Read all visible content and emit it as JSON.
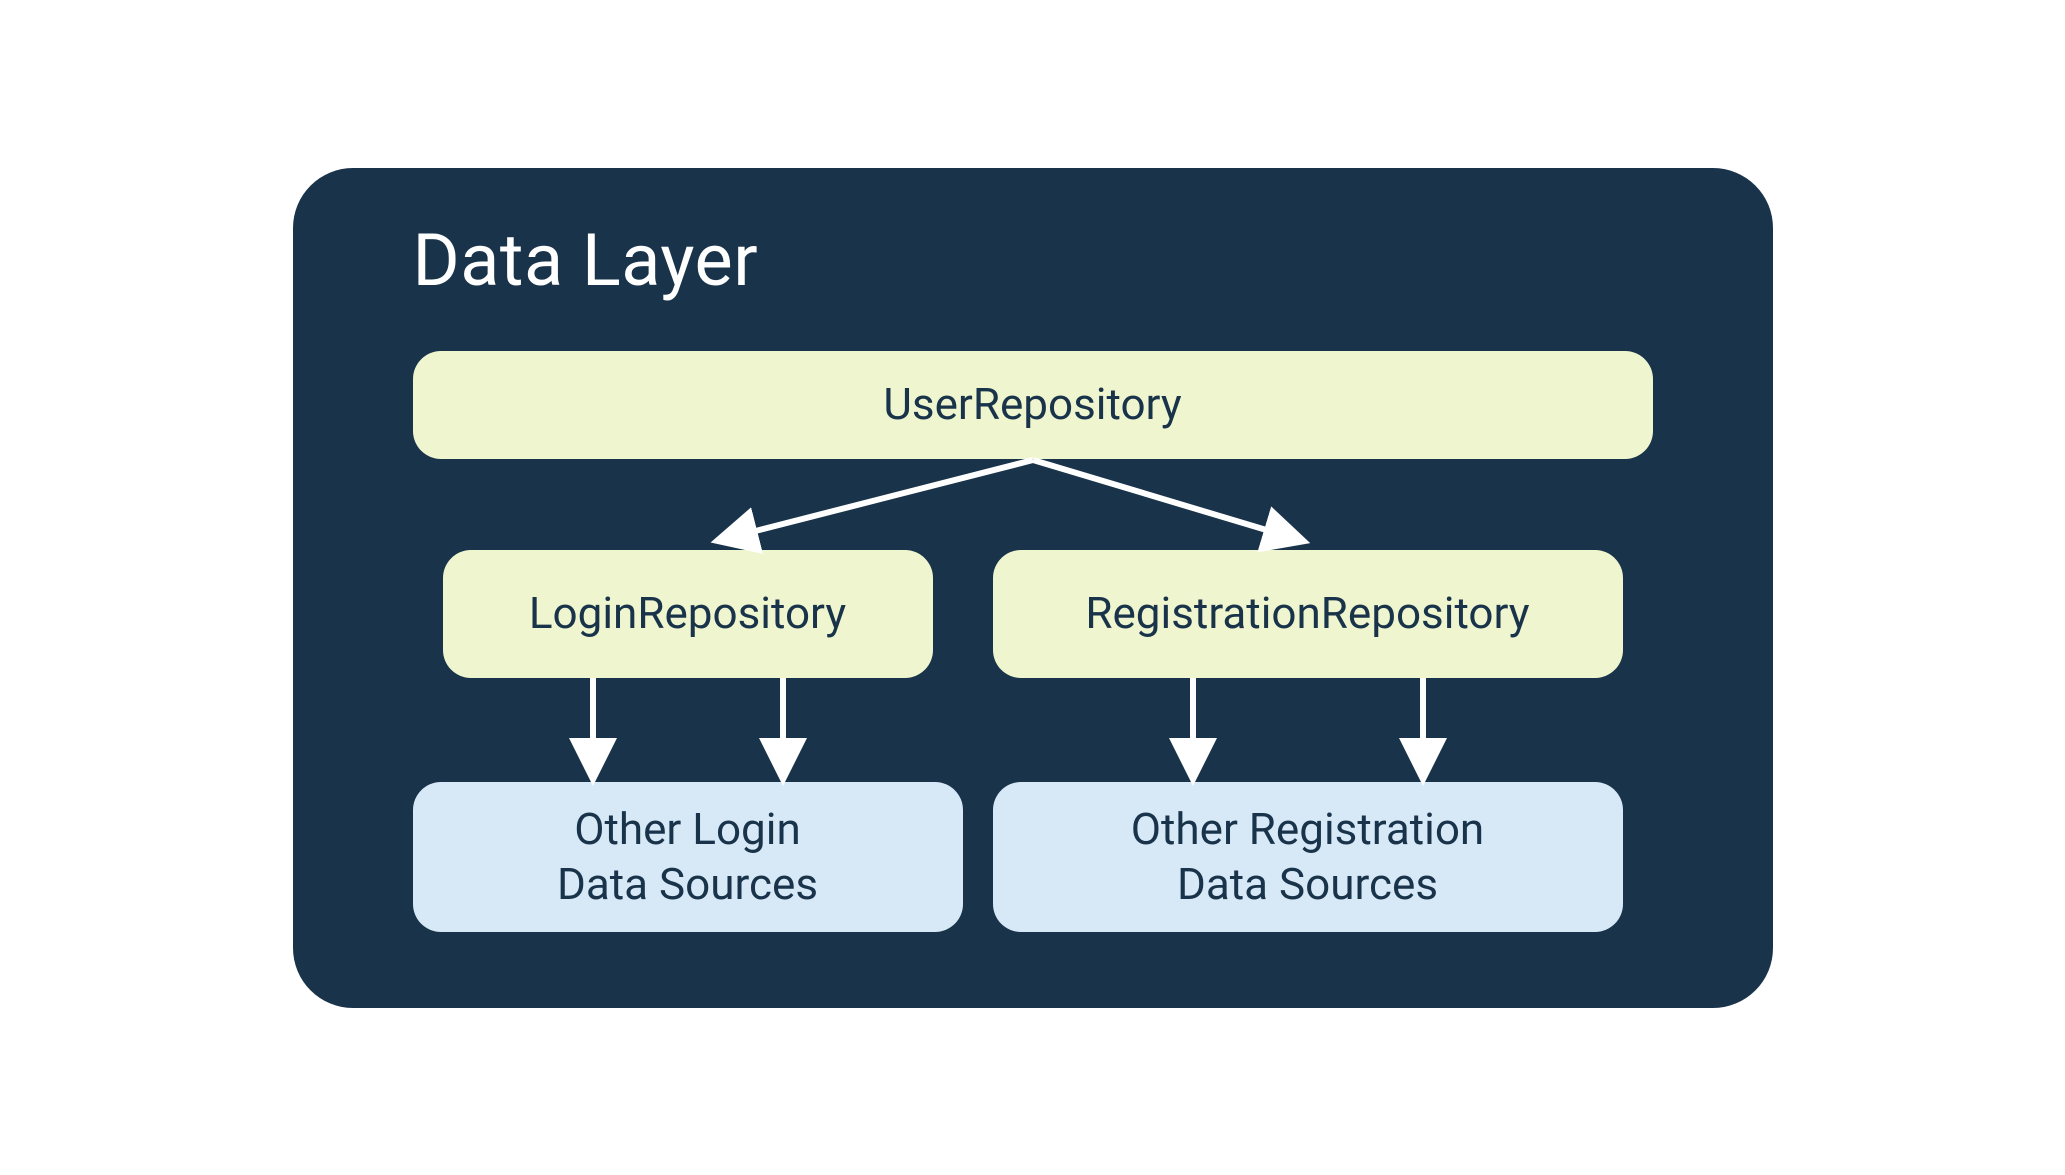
{
  "title": "Data Layer",
  "colors": {
    "background_panel": "#19344a",
    "box_green": "#eff5ce",
    "box_blue": "#d7e9f7",
    "text_on_box": "#19344a",
    "arrow": "#ffffff"
  },
  "nodes": {
    "user_repository": {
      "label": "UserRepository",
      "style": "green"
    },
    "login_repository": {
      "label": "LoginRepository",
      "style": "green"
    },
    "registration_repository": {
      "label": "RegistrationRepository",
      "style": "green"
    },
    "login_data_sources": {
      "label_line1": "Other Login",
      "label_line2": "Data Sources",
      "style": "blue"
    },
    "registration_data_sources": {
      "label_line1": "Other Registration",
      "label_line2": "Data Sources",
      "style": "blue"
    }
  },
  "edges": [
    {
      "from": "user_repository",
      "to": "login_repository"
    },
    {
      "from": "user_repository",
      "to": "registration_repository"
    },
    {
      "from": "login_repository",
      "to": "login_data_sources",
      "count": 2
    },
    {
      "from": "registration_repository",
      "to": "registration_data_sources",
      "count": 2
    }
  ]
}
